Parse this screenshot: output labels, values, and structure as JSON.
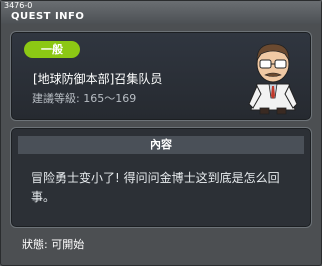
{
  "window": {
    "quest_id": "3476-0",
    "title": "QUEST INFO"
  },
  "quest": {
    "category_tag": "一般",
    "name": "[地球防御本部]召集队员",
    "level": "建議等級: 165～169",
    "npc_icon": "npc-doctor-portrait"
  },
  "content": {
    "header": "內容",
    "description": "冒险勇士变小了! 得问问金博士这到底是怎么回事。"
  },
  "status": {
    "label": "狀態:  可開始"
  },
  "colors": {
    "tag_green": "#8cc814",
    "panel_border": "#6d7378",
    "window_bg": "#4c4f52"
  }
}
